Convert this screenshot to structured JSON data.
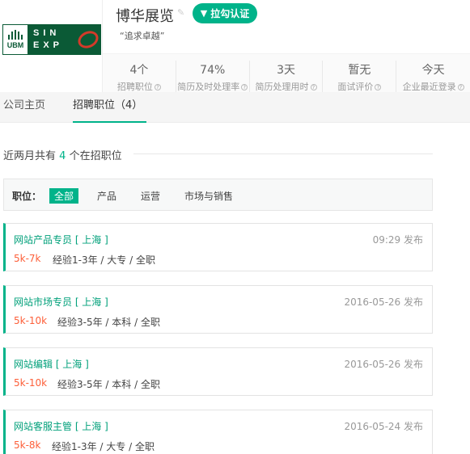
{
  "company": {
    "logo_text_left": "UBM",
    "logo_word_top": "SIN",
    "logo_word_bottom": "EXP",
    "name": "博华展览",
    "verify_label": "拉勾认证",
    "slogan": "“追求卓越”"
  },
  "stats": [
    {
      "value": "4个",
      "label": "招聘职位"
    },
    {
      "value": "74%",
      "label": "简历及时处理率"
    },
    {
      "value": "3天",
      "label": "简历处理用时"
    },
    {
      "value": "暂无",
      "label": "面试评价"
    },
    {
      "value": "今天",
      "label": "企业最近登录"
    }
  ],
  "tabs": [
    {
      "label": "公司主页"
    },
    {
      "label": "招聘职位（4）"
    }
  ],
  "summary": {
    "prefix": "近两月共有",
    "count": "4",
    "suffix": "个在招职位"
  },
  "filter": {
    "label": "职位：",
    "options": [
      "全部",
      "产品",
      "运营",
      "市场与销售"
    ]
  },
  "jobs": [
    {
      "title": "网站产品专员 [ 上海 ]",
      "time": "09:29 发布",
      "salary": "5k-7k",
      "req": "经验1-3年 / 大专 / 全职"
    },
    {
      "title": "网站市场专员 [ 上海 ]",
      "time": "2016-05-26 发布",
      "salary": "5k-10k",
      "req": "经验3-5年 / 本科 / 全职"
    },
    {
      "title": "网站编辑 [ 上海 ]",
      "time": "2016-05-26 发布",
      "salary": "5k-10k",
      "req": "经验3-5年 / 本科 / 全职"
    },
    {
      "title": "网站客服主管 [ 上海 ]",
      "time": "2016-05-24 发布",
      "salary": "5k-8k",
      "req": "经验1-3年 / 大专 / 全职"
    }
  ],
  "colors": {
    "accent": "#00b38a",
    "salary": "#fd5f39",
    "logo_green": "#0b5a36",
    "logo_red": "#d43a2a"
  }
}
